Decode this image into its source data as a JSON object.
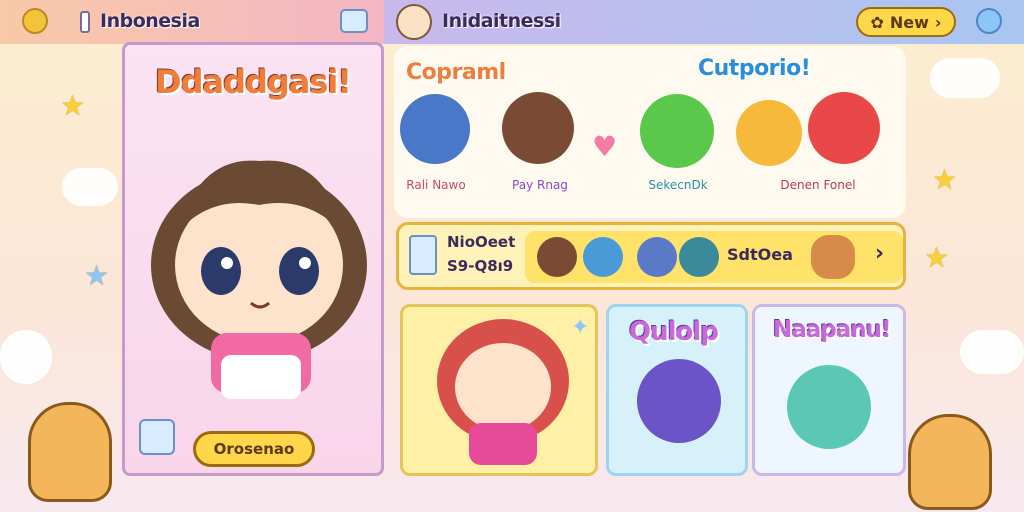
{
  "header": {
    "left_title": "Inbonesia",
    "right_title": "Inidaitnessi",
    "new_button": "New"
  },
  "profile": {
    "name": "Ddaddgasi!",
    "confirm_button": "Orosenao"
  },
  "roster": {
    "title_left": "Copraml",
    "title_right": "Cutporio!",
    "characters": [
      {
        "name": "Rali Nawo"
      },
      {
        "name": "Pay Rnag"
      },
      {
        "name": "SekecnDk"
      },
      {
        "name": "Denen Fonel"
      }
    ]
  },
  "event": {
    "title": "NioOeet",
    "time": "S9-Q8ı9",
    "label": "SdtOea"
  },
  "cards": {
    "card2_title": "Qulolp",
    "card3_title": "Naapanu!"
  },
  "colors": {
    "accent_yellow": "#ffd84a",
    "panel_pink": "#fbe3f3",
    "header_purple": "#c9b8ec"
  }
}
